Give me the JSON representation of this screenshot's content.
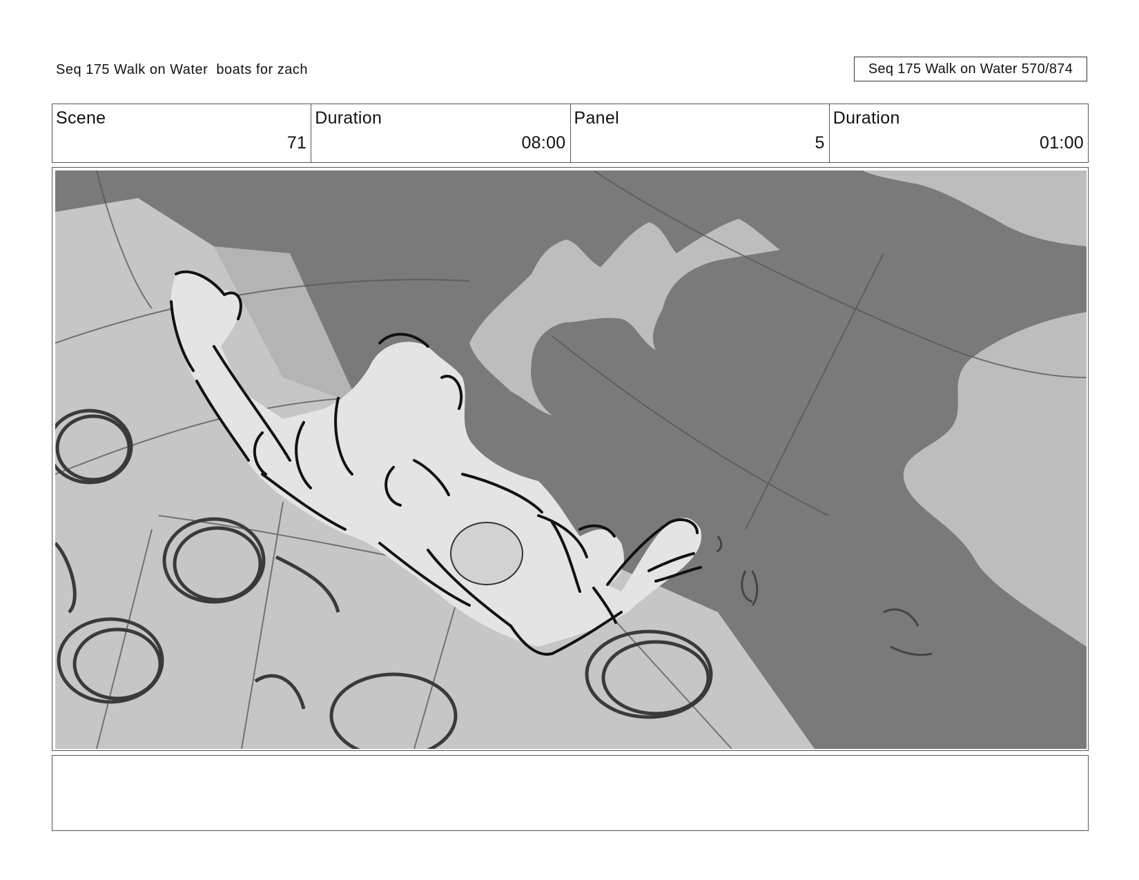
{
  "header": {
    "title": "Seq 175 Walk on Water  boats for zach",
    "page_label": "Seq 175 Walk on Water 570/874"
  },
  "info": [
    {
      "label": "Scene",
      "value": "71"
    },
    {
      "label": "Duration",
      "value": "08:00"
    },
    {
      "label": "Panel",
      "value": "5"
    },
    {
      "label": "Duration",
      "value": "01:00"
    }
  ],
  "panel": {
    "image": "storyboard-sketch",
    "colors": {
      "water": "#7a7a7a",
      "deck": "#c6c6c6",
      "splash": "#bdbdbd",
      "figure": "#e4e4e4",
      "ink": "#111111"
    }
  },
  "notes": {
    "text": ""
  }
}
